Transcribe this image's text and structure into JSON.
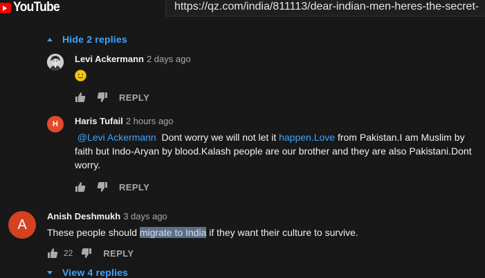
{
  "header": {
    "logo_text": "YouTube",
    "url": "https://qz.com/india/811113/dear-indian-men-heres-the-secret-"
  },
  "thread": {
    "hide_replies_label": "Hide 2 replies",
    "replies": [
      {
        "author": "Levi Ackermann",
        "time": "2 days ago",
        "emoji": "slightly-smiling-face",
        "reply_label": "REPLY"
      },
      {
        "author": "Haris Tufail",
        "time": "2 hours ago",
        "avatar_letter": "H",
        "mention": "@Levi Ackermann",
        "text_part1": "  Dont worry we will not let it ",
        "link_text": "happen.Love",
        "text_part2": " from Pakistan.I am Muslim by faith but Indo-Aryan by blood.Kalash people are our brother and they are also Pakistani.Dont worry.",
        "reply_label": "REPLY"
      }
    ]
  },
  "comment": {
    "author": "Anish Deshmukh",
    "time": "3 days ago",
    "avatar_letter": "A",
    "text_before": "These people should ",
    "text_selected": "migrate to India",
    "text_after": " if they want their culture to survive.",
    "like_count": "22",
    "reply_label": "REPLY",
    "view_replies_label": "View 4 replies"
  },
  "colors": {
    "background": "#181818",
    "link": "#3ea6ff",
    "muted": "#aaaaaa",
    "youtube_red": "#ff0000",
    "avatar_haris": "#e4492c",
    "avatar_anish": "#d5421f"
  }
}
